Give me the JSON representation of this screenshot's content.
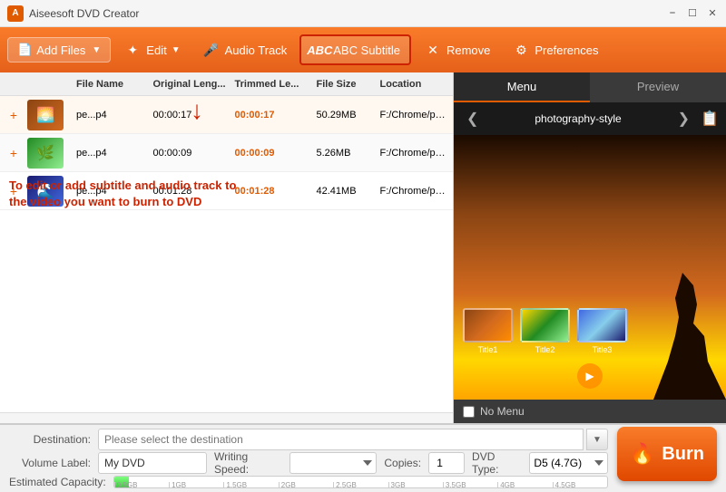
{
  "app": {
    "title": "Aiseesoft DVD Creator",
    "window_controls": [
      "minimize",
      "maximize",
      "close"
    ]
  },
  "toolbar": {
    "add_files_label": "Add Files",
    "edit_label": "Edit",
    "audio_track_label": "Audio Track",
    "subtitle_label": "ABC Subtitle",
    "remove_label": "Remove",
    "preferences_label": "Preferences"
  },
  "file_list": {
    "columns": [
      "",
      "",
      "File Name",
      "Original Length",
      "Trimmed Length",
      "File Size",
      "Location"
    ],
    "rows": [
      {
        "name": "pe...p4",
        "original_length": "00:00:17",
        "trimmed_length": "00:00:17",
        "file_size": "50.29MB",
        "location": "F:/Chrome/pexels-gylfi-g...",
        "thumb_style": "brown"
      },
      {
        "name": "pe...p4",
        "original_length": "00:00:09",
        "trimmed_length": "00:00:09",
        "file_size": "5.26MB",
        "location": "F:/Chrome/pexels-zuzann...",
        "thumb_style": "green"
      },
      {
        "name": "pe...p4",
        "original_length": "00:01:28",
        "trimmed_length": "00:01:28",
        "file_size": "42.41MB",
        "location": "F:/Chrome/pexels-super-l...",
        "thumb_style": "blue"
      }
    ]
  },
  "annotation": {
    "text": "To edit or add subtitle and audio track to the video you want to burn to DVD"
  },
  "right_panel": {
    "tabs": [
      "Menu",
      "Preview"
    ],
    "active_tab": "Menu",
    "theme_name": "photography-style",
    "titles": [
      "Title1",
      "Title2",
      "Title3"
    ],
    "no_menu_label": "No Menu"
  },
  "bottom": {
    "destination_label": "Destination:",
    "destination_placeholder": "Please select the destination",
    "volume_label": "Volume Label:",
    "volume_value": "My DVD",
    "writing_speed_label": "Writing Speed:",
    "copies_label": "Copies:",
    "copies_value": "1",
    "dvd_type_label": "DVD Type:",
    "dvd_type_value": "D5 (4.7G)",
    "capacity_label": "Estimated Capacity:",
    "capacity_ticks": [
      "0.5GB",
      "1GB",
      "1.5GB",
      "2GB",
      "2.5GB",
      "3GB",
      "3.5GB",
      "4GB",
      "4.5GB"
    ],
    "burn_label": "Burn"
  }
}
